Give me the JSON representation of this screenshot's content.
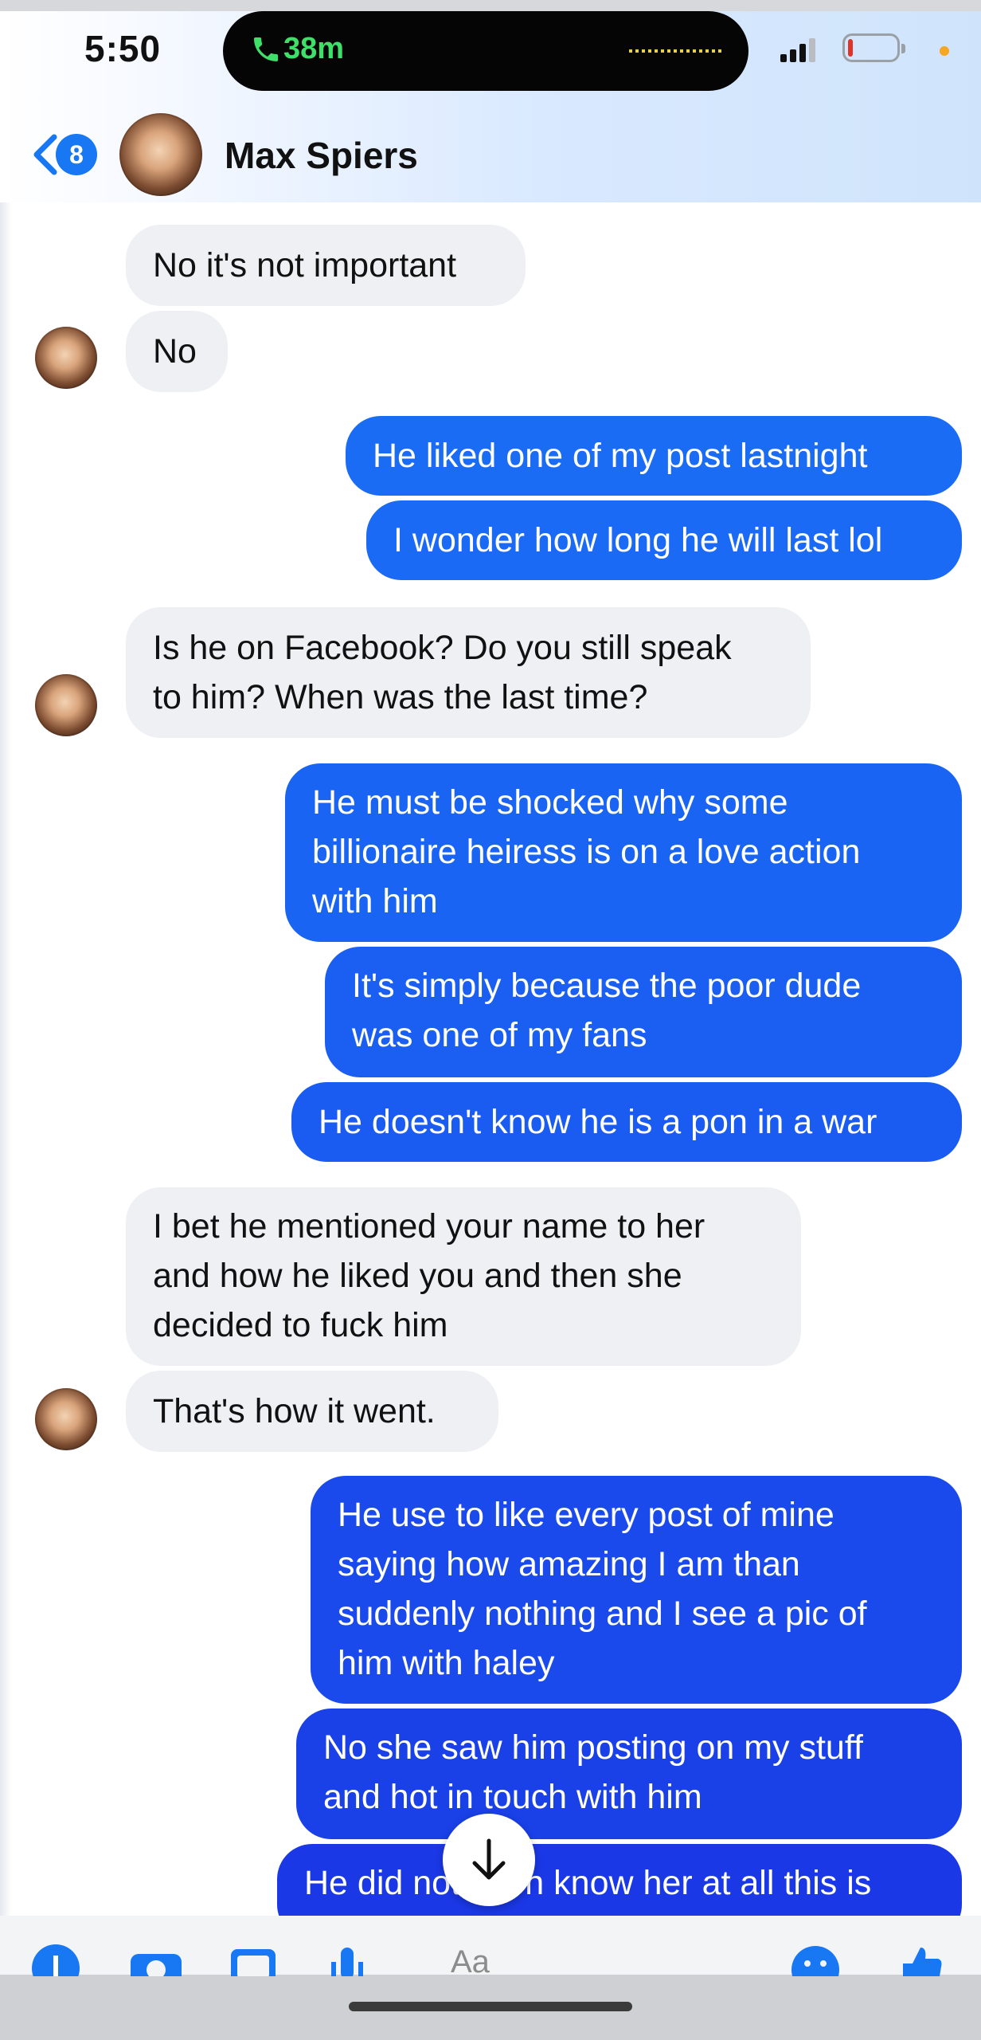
{
  "status_bar": {
    "time": "5:50",
    "call_duration": "38m"
  },
  "header": {
    "unread_count": "8",
    "contact_name": "Max Spiers"
  },
  "messages": [
    {
      "side": "in",
      "lines": [
        "No it's not important"
      ]
    },
    {
      "side": "in",
      "lines": [
        "No"
      ]
    },
    {
      "side": "out",
      "lines": [
        "He liked one of my post lastnight"
      ]
    },
    {
      "side": "out",
      "lines": [
        "I wonder how long he will last lol"
      ]
    },
    {
      "side": "in",
      "lines": [
        "Is he on Facebook? Do you still speak",
        "to him? When was the last time?"
      ]
    },
    {
      "side": "out",
      "lines": [
        "He must be shocked why some",
        "billionaire heiress is on a love  action",
        "with him"
      ]
    },
    {
      "side": "out",
      "lines": [
        "It's simply because the poor dude",
        "was one of my fans"
      ]
    },
    {
      "side": "out",
      "lines": [
        "He doesn't know he is a pon in a war"
      ]
    },
    {
      "side": "in",
      "lines": [
        "I bet he mentioned your name to her",
        "and how he liked you and then she",
        "decided to fuck him"
      ]
    },
    {
      "side": "in",
      "lines": [
        "That's how it went."
      ]
    },
    {
      "side": "out",
      "lines": [
        "He use to like every post of mine",
        "saying how amazing I am than",
        "suddenly nothing and I see a pic of",
        "him with haley"
      ]
    },
    {
      "side": "out",
      "lines": [
        "No she saw him posting on my stuff",
        "and hot in touch with him"
      ]
    },
    {
      "side": "out",
      "lines": [
        "He did not even know her at all this is"
      ]
    }
  ],
  "composer": {
    "placeholder": "Aa"
  },
  "icons": [
    "phone-icon",
    "signal-icon",
    "battery-icon",
    "back-chevron-icon",
    "scroll-down-icon",
    "plus-icon",
    "camera-icon",
    "gallery-icon",
    "microphone-icon",
    "emoji-icon",
    "like-icon"
  ],
  "colors": {
    "incoming_bubble": "#eef0f3",
    "outgoing_top": "#1a6cf7",
    "outgoing_bottom": "#1435e2",
    "accent": "#1877f2",
    "call_green": "#3ee06a"
  }
}
